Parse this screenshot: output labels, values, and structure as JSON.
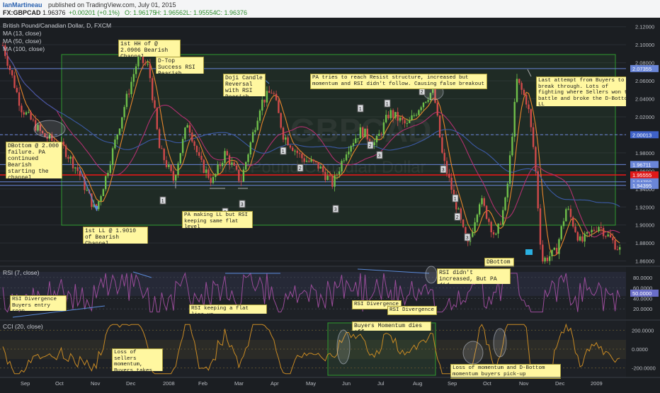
{
  "header": {
    "author": "IanMartineau",
    "published": "published on TradingView.com, July 01, 2015",
    "symbol": "FX:GBPCAD",
    "price": "1.96376",
    "change": "+0.00201 (+0.1%)",
    "open": "O: 1.96175",
    "high": "H: 1.96562",
    "low": "L: 1.95554",
    "close": "C: 1.96376"
  },
  "legend": {
    "title": "British Pound/Canadian Dollar, D, FXCM",
    "ma1": "MA (13, close)",
    "ma2": "MA (50, close)",
    "ma3": "MA (100, close)"
  },
  "watermark": {
    "ticker": "GBPCAD",
    "name": "British Pound/Canadian Dollar"
  },
  "colors": {
    "background": "#1b1e22",
    "candle_up": "#6fbf4a",
    "candle_down": "#d04a4a",
    "ma13": "#e8862c",
    "ma50": "#b0306e",
    "ma100": "#3c5aa6",
    "hline_blue": "#6a86d8",
    "hline_red": "#e01818",
    "box": "#2f9a2f",
    "rsi": "#9a4c9a",
    "cci": "#c88a24",
    "note_bg": "#fff7a0",
    "note_text": "#1a1a1a"
  },
  "price_axis": {
    "ticks": [
      "2.12000",
      "2.10000",
      "2.08000",
      "2.06000",
      "2.04000",
      "2.02000",
      "2.00000",
      "1.98000",
      "1.96000",
      "1.94000",
      "1.92000",
      "1.90000",
      "1.88000",
      "1.86000"
    ],
    "badges": [
      {
        "label": "2.07355",
        "value": 2.07355,
        "color": "#6a86d8"
      },
      {
        "label": "2.00013",
        "value": 2.00013,
        "color": "#3f62c9"
      },
      {
        "label": "1.96711",
        "value": 1.96711,
        "color": "#6a86d8"
      },
      {
        "label": "1.95555",
        "value": 1.95555,
        "color": "#e01818"
      },
      {
        "label": "1.94790",
        "value": 1.9479,
        "color": "#6a86d8"
      },
      {
        "label": "1.94395",
        "value": 1.94395,
        "color": "#6a86d8"
      }
    ]
  },
  "time_axis": [
    "Sep",
    "Oct",
    "Nov",
    "Dec",
    "2008",
    "Feb",
    "Mar",
    "Apr",
    "May",
    "Jun",
    "Jul",
    "Aug",
    "Sep",
    "Oct",
    "Nov",
    "Dec",
    "2009"
  ],
  "annotations": {
    "dbottom": "DBottom @ 2.000 failure. PA continued Bearish starting the channel",
    "first_hh": "1st HH of @ 2.0906 Bearish Channel",
    "dtop": "D-Top Success RSI Bearish",
    "doji": "Doji Candle Reversal with RSI Bearish",
    "pa_resist": "PA tries to reach Resist structure, increased but momentum and RSI didn't follow. Causing false breakout",
    "last_attempt": "Last attempt from Buyers to break through. Lots of fighting where Sellers won the battle and broke the D-Bottom LL",
    "first_ll": "1st LL @ 1.9010 of Bearish Channel",
    "pa_ll": "PA making LL but RSI keeping same flat level",
    "dbottom2": "DBottom",
    "rsi_div1": "RSI Divergence Buyers entry soon",
    "rsi_flat": "RSI keeping a flat line-up",
    "rsi_div2": "RSI Divergence",
    "rsi_div3": "RSI Divergence",
    "rsi_not": "RSI didn't increased, But PA did.",
    "buyers_mom": "Buyers Momentum dies off",
    "loss_sellers": "Loss of sellers momentum, Buyers takes over",
    "loss_mom": "Loss of momentum and D-Bottom momentum buyers pick-up"
  },
  "rsi_panel": {
    "label": "RSI (7, close)",
    "ticks": [
      "80.0000",
      "60.0000",
      "40.0000",
      "20.0000"
    ],
    "current": "50.0000"
  },
  "cci_panel": {
    "label": "CCI (20, close)",
    "ticks": [
      "200.0000",
      "0.0000",
      "-200.0000"
    ]
  },
  "wave_labels": [
    "1",
    "2",
    "3",
    "1",
    "2",
    "3",
    "1",
    "2",
    "3",
    "1",
    "2",
    "3",
    "1",
    "2",
    "3"
  ],
  "chart_data": {
    "type": "candlestick",
    "title": "British Pound/Canadian Dollar, D, FXCM",
    "ylim": [
      1.855,
      2.13
    ],
    "horizontal_levels": [
      2.07355,
      2.00013,
      1.96711,
      1.95555,
      1.9479,
      1.94395
    ],
    "channel_range": [
      1.901,
      2.0906
    ],
    "series": [
      {
        "name": "MA (13, close)"
      },
      {
        "name": "MA (50, close)"
      },
      {
        "name": "MA (100, close)"
      }
    ],
    "rsi": {
      "period": 7,
      "ylim": [
        0,
        100
      ],
      "levels": [
        80,
        60,
        40,
        20
      ]
    },
    "cci": {
      "period": 20,
      "ylim": [
        -300,
        300
      ],
      "levels": [
        200,
        0,
        -200
      ]
    }
  }
}
